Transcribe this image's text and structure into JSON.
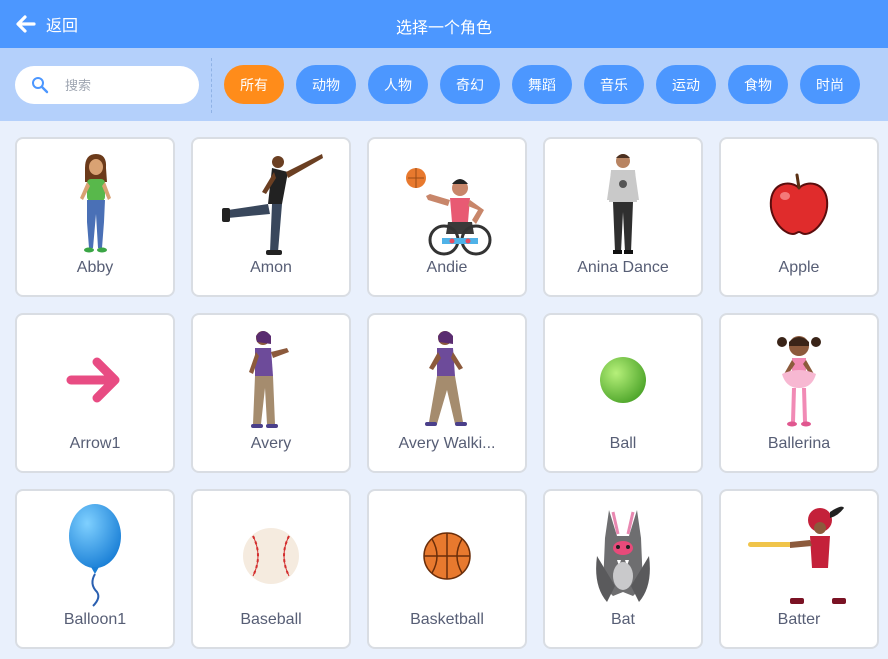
{
  "header": {
    "back_label": "返回",
    "title": "选择一个角色"
  },
  "search": {
    "placeholder": "搜索"
  },
  "tags": [
    {
      "label": "所有",
      "active": true
    },
    {
      "label": "动物",
      "active": false
    },
    {
      "label": "人物",
      "active": false
    },
    {
      "label": "奇幻",
      "active": false
    },
    {
      "label": "舞蹈",
      "active": false
    },
    {
      "label": "音乐",
      "active": false
    },
    {
      "label": "运动",
      "active": false
    },
    {
      "label": "食物",
      "active": false
    },
    {
      "label": "时尚",
      "active": false
    }
  ],
  "sprites": [
    {
      "name": "Abby",
      "icon": "abby-sprite-icon"
    },
    {
      "name": "Amon",
      "icon": "amon-sprite-icon"
    },
    {
      "name": "Andie",
      "icon": "andie-sprite-icon"
    },
    {
      "name": "Anina Dance",
      "icon": "anina-dance-sprite-icon"
    },
    {
      "name": "Apple",
      "icon": "apple-sprite-icon"
    },
    {
      "name": "Arrow1",
      "icon": "arrow-sprite-icon"
    },
    {
      "name": "Avery",
      "icon": "avery-sprite-icon"
    },
    {
      "name": "Avery Walki...",
      "icon": "avery-walking-sprite-icon"
    },
    {
      "name": "Ball",
      "icon": "ball-sprite-icon"
    },
    {
      "name": "Ballerina",
      "icon": "ballerina-sprite-icon"
    },
    {
      "name": "Balloon1",
      "icon": "balloon-sprite-icon"
    },
    {
      "name": "Baseball",
      "icon": "baseball-sprite-icon"
    },
    {
      "name": "Basketball",
      "icon": "basketball-sprite-icon"
    },
    {
      "name": "Bat",
      "icon": "bat-sprite-icon"
    },
    {
      "name": "Batter",
      "icon": "batter-sprite-icon"
    }
  ],
  "colors": {
    "header": "#4c97ff",
    "filter_bar": "#b4d0fb",
    "active_tag": "#ff8c1a",
    "tag": "#4c97ff",
    "background": "#e9f0fc"
  }
}
